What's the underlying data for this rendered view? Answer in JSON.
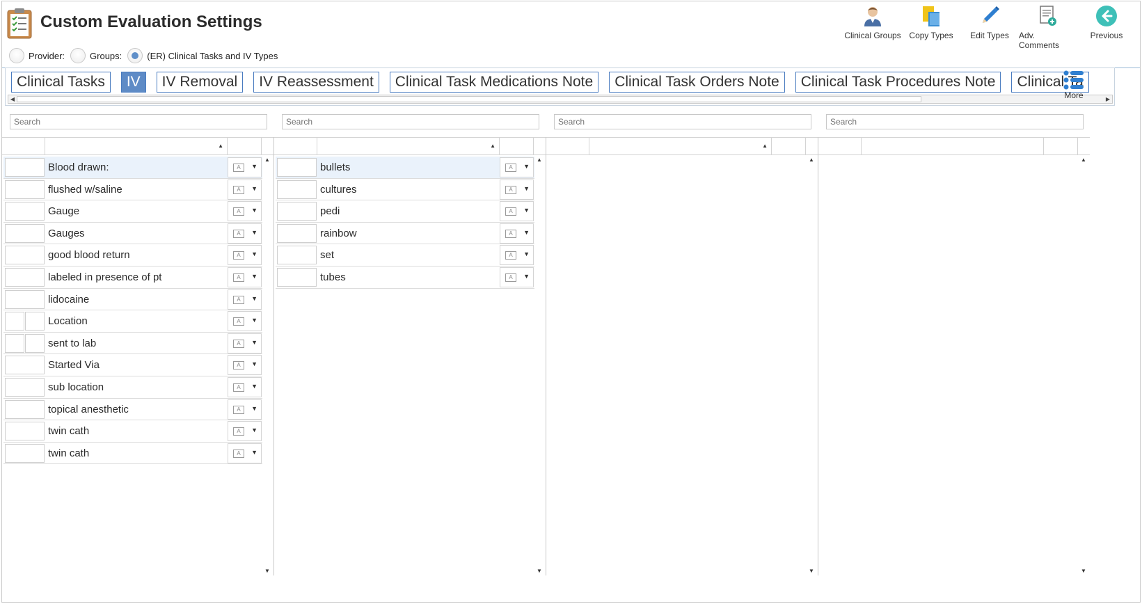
{
  "app": {
    "title": "Custom Evaluation Settings"
  },
  "scope": {
    "options": [
      {
        "label": "Provider:",
        "checked": false
      },
      {
        "label": "Groups:",
        "checked": false
      },
      {
        "label": "(ER) Clinical Tasks and IV Types",
        "checked": true
      }
    ]
  },
  "toolbar": {
    "buttons": [
      {
        "label": "Clinical Groups",
        "icon": "clinical-groups-icon"
      },
      {
        "label": "Copy Types",
        "icon": "copy-types-icon"
      },
      {
        "label": "Edit Types",
        "icon": "pencil-icon"
      },
      {
        "label": "Adv. Comments",
        "icon": "document-add-icon"
      },
      {
        "label": "Previous",
        "icon": "back-arrow-icon"
      }
    ]
  },
  "tabs": [
    {
      "label": "Clinical Tasks",
      "active": false
    },
    {
      "label": "IV",
      "active": true
    },
    {
      "label": "IV Removal",
      "active": false
    },
    {
      "label": "IV Reassessment",
      "active": false
    },
    {
      "label": "Clinical Task Medications Note",
      "active": false
    },
    {
      "label": "Clinical Task Orders Note",
      "active": false
    },
    {
      "label": "Clinical Task Procedures Note",
      "active": false
    },
    {
      "label": "Clinical Ta",
      "active": false
    }
  ],
  "more": {
    "label": "More",
    "icon": "list-icon"
  },
  "search": {
    "placeholder": "Search"
  },
  "panels": [
    {
      "rows": [
        {
          "label": "Blood drawn:",
          "selected": true,
          "split": false
        },
        {
          "label": "flushed w/saline",
          "split": false
        },
        {
          "label": "Gauge",
          "split": false
        },
        {
          "label": "Gauges",
          "split": false
        },
        {
          "label": "good blood return",
          "split": false
        },
        {
          "label": "labeled in presence of pt",
          "split": false
        },
        {
          "label": "lidocaine",
          "split": false
        },
        {
          "label": "Location",
          "split": true
        },
        {
          "label": "sent to lab",
          "split": true
        },
        {
          "label": "Started Via",
          "split": false
        },
        {
          "label": "sub location",
          "split": false
        },
        {
          "label": "topical anesthetic",
          "split": false
        },
        {
          "label": "twin cath",
          "split": false
        },
        {
          "label": "twin cath",
          "split": false
        }
      ]
    },
    {
      "rows": [
        {
          "label": "bullets",
          "selected": true,
          "split": false
        },
        {
          "label": "cultures",
          "split": false
        },
        {
          "label": "pedi",
          "split": false
        },
        {
          "label": "rainbow",
          "split": false
        },
        {
          "label": "set",
          "split": false
        },
        {
          "label": "tubes",
          "split": false
        }
      ]
    },
    {
      "rows": []
    },
    {
      "rows": []
    }
  ],
  "colors": {
    "accent": "#5e8bc6",
    "tab_border": "#4a7cc0",
    "selected_row": "#eaf2fb"
  }
}
